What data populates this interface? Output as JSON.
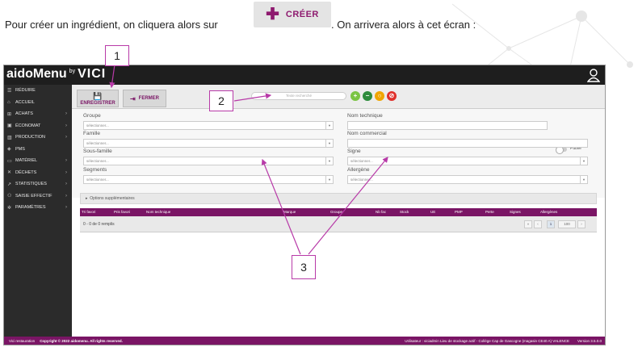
{
  "document": {
    "intro_before": "Pour créer un ingrédient, on cliquera alors sur",
    "intro_after": ". On arrivera alors à cet écran :",
    "creer_button": {
      "icon": "plus-icon",
      "label": "CRÉER"
    }
  },
  "app": {
    "logo_brand": "aidoMenu",
    "logo_by": "by",
    "logo_vici": "VICI",
    "sidebar": {
      "items": [
        {
          "label": "RÉDUIRE",
          "icon": "menu-icon",
          "has_chevron": false
        },
        {
          "label": "ACCUEIL",
          "icon": "home-icon",
          "has_chevron": false
        },
        {
          "label": "ACHATS",
          "icon": "cart-icon",
          "has_chevron": true
        },
        {
          "label": "ÉCONOMAT",
          "icon": "box-icon",
          "has_chevron": true
        },
        {
          "label": "PRODUCTION",
          "icon": "chart-icon",
          "has_chevron": true
        },
        {
          "label": "PMS",
          "icon": "shield-icon",
          "has_chevron": false
        },
        {
          "label": "MATÉRIEL",
          "icon": "monitor-icon",
          "has_chevron": true
        },
        {
          "label": "DÉCHETS",
          "icon": "trash-icon",
          "has_chevron": true
        },
        {
          "label": "STATISTIQUES",
          "icon": "line-chart-icon",
          "has_chevron": true
        },
        {
          "label": "SAISIE EFFECTIF",
          "icon": "users-icon",
          "has_chevron": true
        },
        {
          "label": "PARAMÈTRES",
          "icon": "gear-icon",
          "has_chevron": true
        }
      ]
    },
    "toolbar": {
      "save_label": "ENREGISTRER",
      "close_label": "FERMER",
      "search_placeholder": "Texte recherché"
    },
    "form": {
      "groupe_label": "Groupe",
      "famille_label": "Famille",
      "sous_famille_label": "Sous-famille",
      "segments_label": "Segments",
      "nom_technique_label": "Nom technique",
      "nom_commercial_label": "Nom commercial",
      "signe_label": "Signe",
      "allergene_label": "Allergène",
      "select_placeholder": "sélectionner...",
      "publie_label": "Publié"
    },
    "options_label": "Options supplémentaires",
    "table": {
      "columns": [
        "Tri favori",
        "Pris favori",
        "Nom technique",
        "Marque",
        "Groupe",
        "Nb fac",
        "Stock",
        "UE",
        "PMP",
        "Perte",
        "Signes",
        "Allergènes"
      ],
      "empty_text": "0 - 0 de 0 remplis",
      "page_current": "1",
      "page_size": "100"
    },
    "footer": {
      "left": "Vici restauration",
      "copyright": "Copyright © 2022 aidomenu. All rights reserved.",
      "user_info": "Utilisateur : viciadmin Lieu de stockage actif - Collège Cap de Gascogne (magasin CE40 A) VALENCE",
      "version": "Version 3.5.0.0"
    }
  },
  "annotations": {
    "one": "1",
    "two": "2",
    "three": "3"
  },
  "colors": {
    "brand": "#7a1565",
    "accent_callout": "#b83aa8"
  }
}
